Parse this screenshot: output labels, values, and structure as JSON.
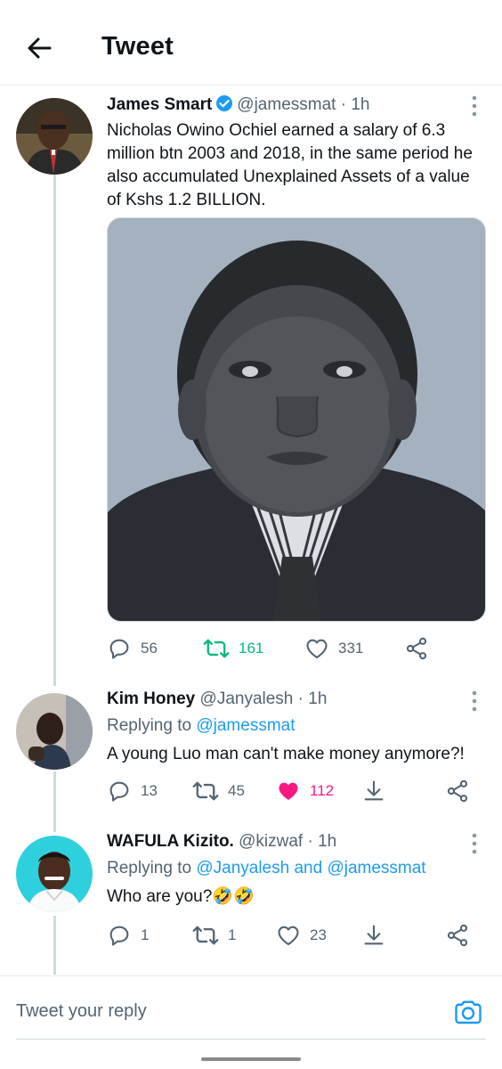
{
  "header": {
    "title": "Tweet"
  },
  "main_tweet": {
    "author_name": "James Smart",
    "author_handle": "@jamessmat",
    "time": "· 1h",
    "text": "Nicholas Owino Ochiel earned a salary of 6.3 million btn 2003 and 2018, in the same period he also accumulated Unexplained Assets of a value of Kshs 1.2 BILLION.",
    "stats": {
      "replies": "56",
      "retweets": "161",
      "likes": "331"
    }
  },
  "replies": [
    {
      "author_name": "Kim Honey",
      "author_handle": "@Janyalesh",
      "time": "· 1h",
      "replying_prefix": "Replying to",
      "replying_mentions": "@jamessmat",
      "text": "A young Luo man can't make money anymore?!",
      "stats": {
        "replies": "13",
        "retweets": "45",
        "likes": "112"
      },
      "liked": true
    },
    {
      "author_name": "WAFULA Kizito.",
      "author_handle": "@kizwaf",
      "time": "· 1h",
      "replying_prefix": "Replying to",
      "replying_mentions": "@Janyalesh and @jamessmat",
      "text": "Who are you?🤣🤣",
      "stats": {
        "replies": "1",
        "retweets": "1",
        "likes": "23"
      },
      "liked": false
    }
  ],
  "composer": {
    "placeholder": "Tweet your reply"
  },
  "colors": {
    "accent": "#1d9bf0",
    "retweet_green": "#00ba7c",
    "like_pink": "#f91880",
    "muted": "#536471"
  },
  "icons": [
    "back-arrow-icon",
    "verified-badge-icon",
    "more-vertical-icon",
    "reply-icon",
    "retweet-icon",
    "like-icon",
    "share-icon",
    "download-icon",
    "camera-icon"
  ]
}
